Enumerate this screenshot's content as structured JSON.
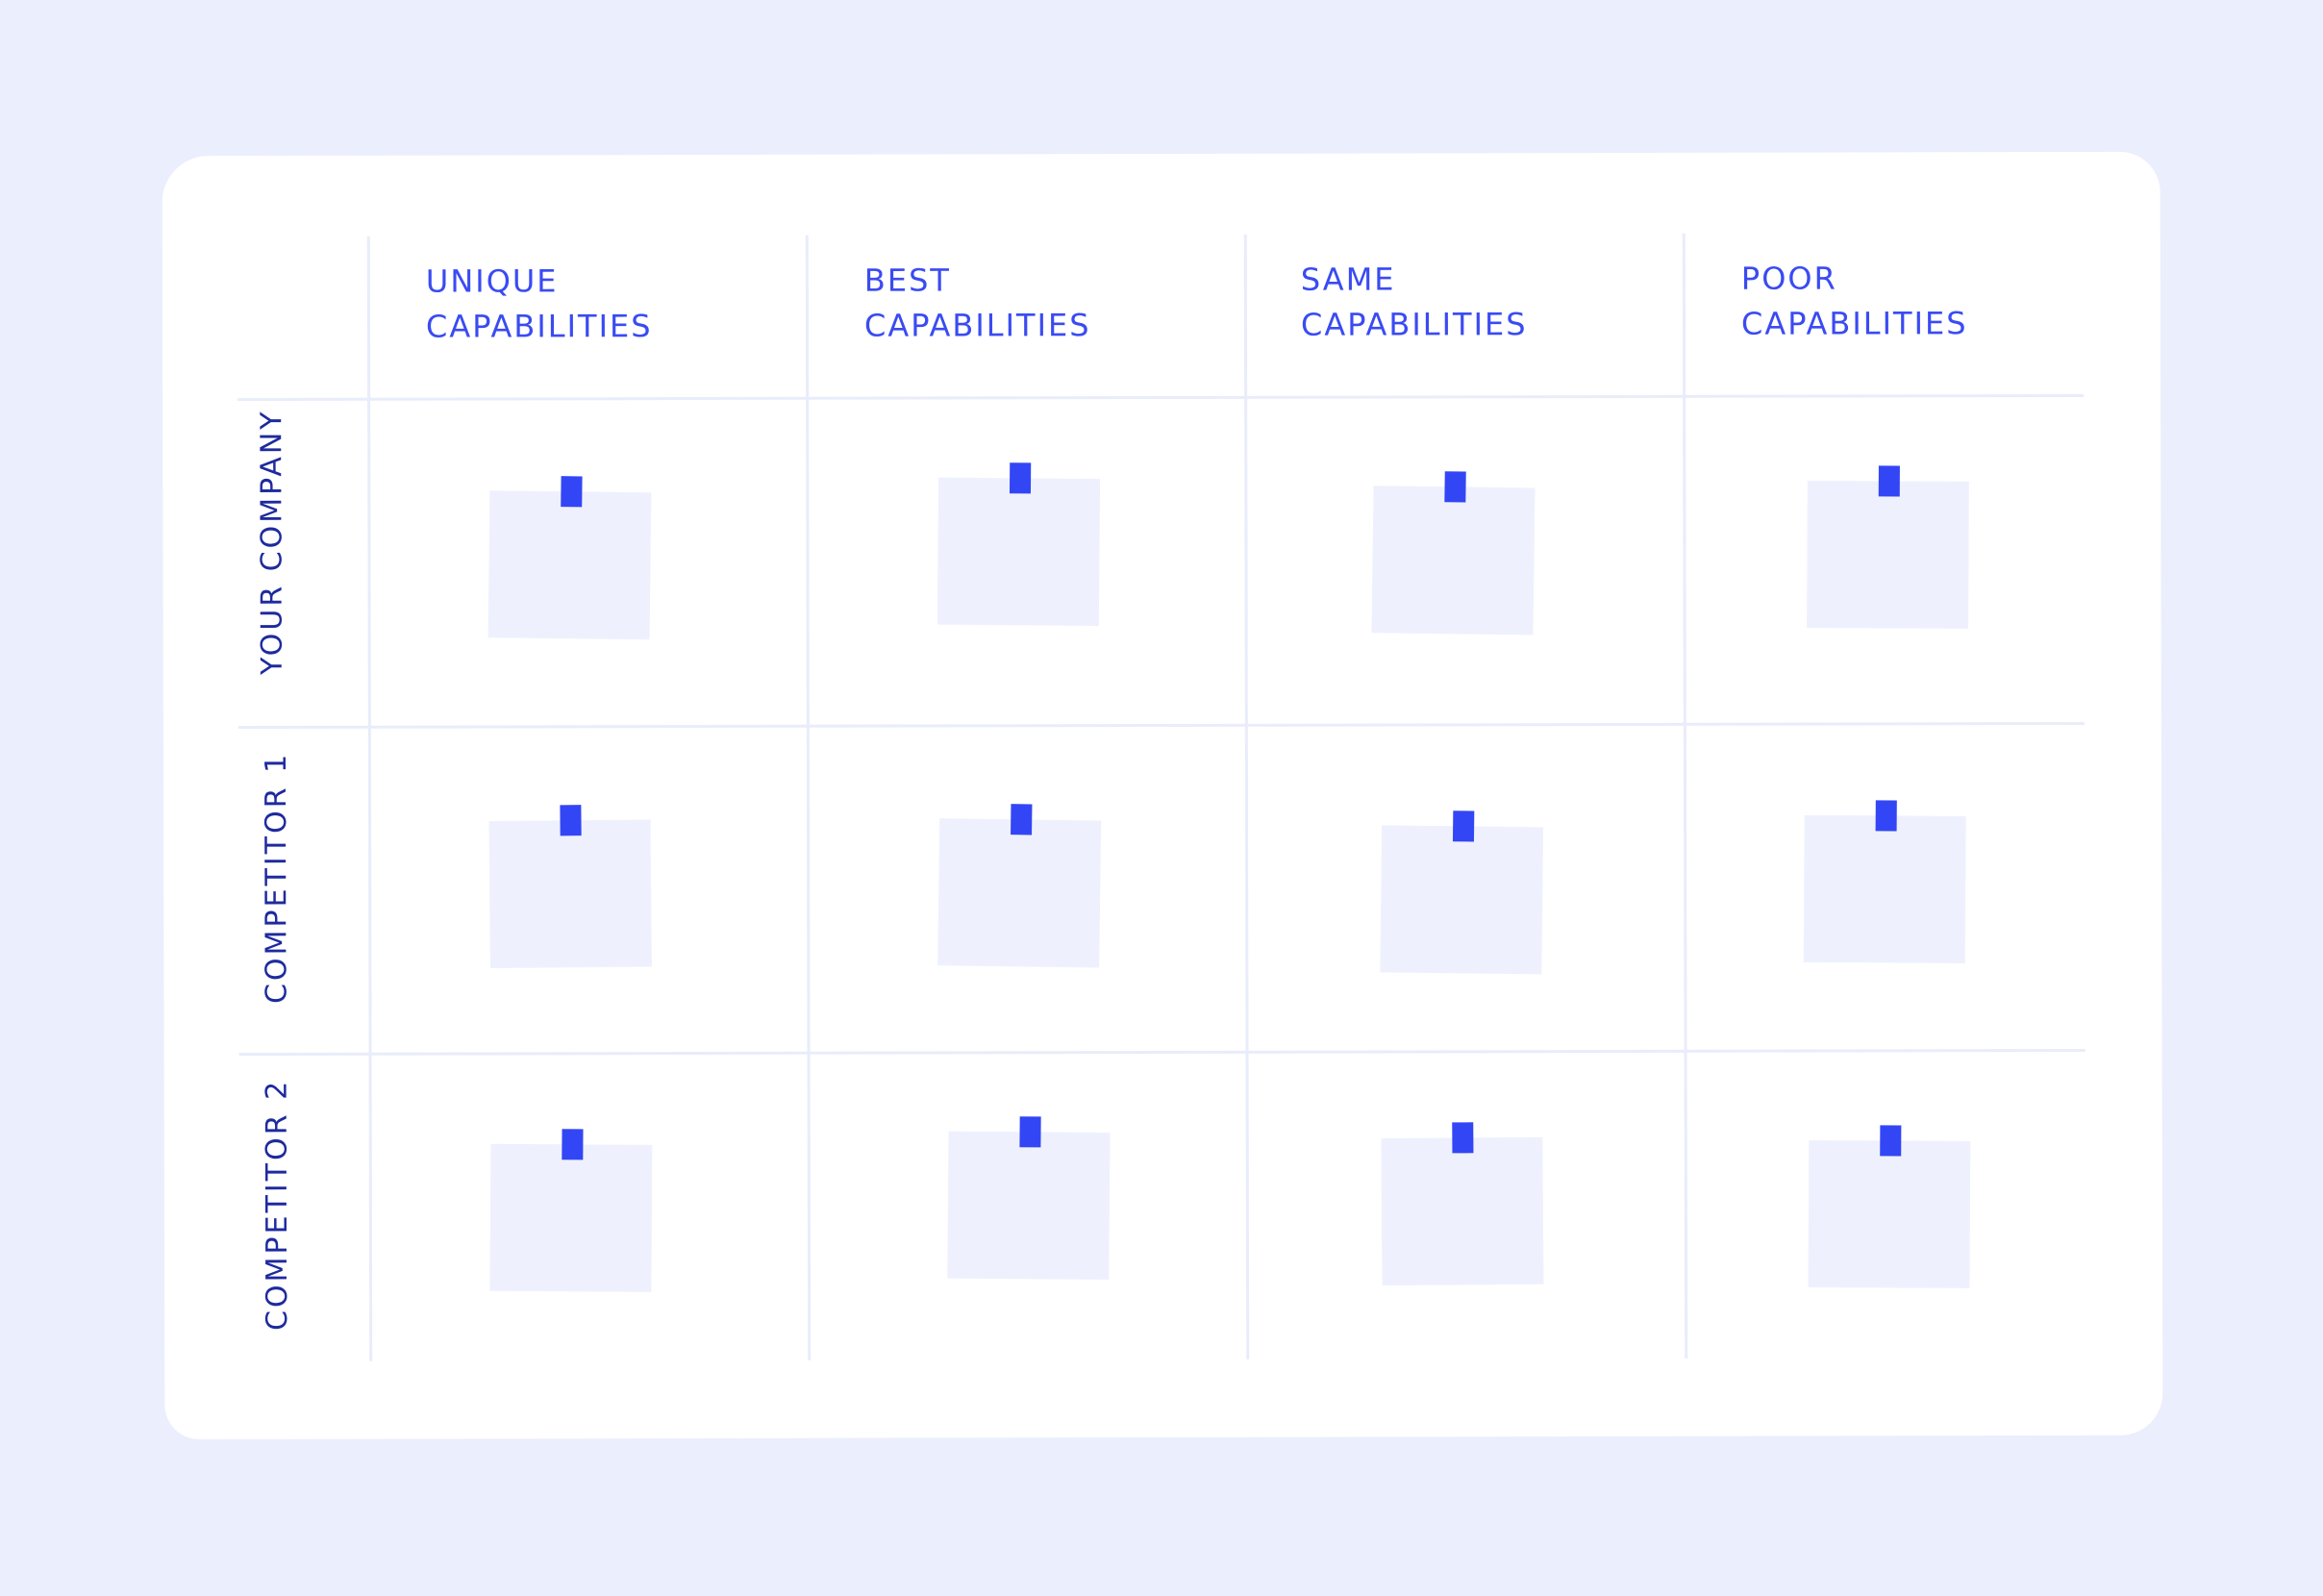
{
  "columns": [
    {
      "line1": "Unique",
      "line2": "capabilities"
    },
    {
      "line1": "Best",
      "line2": "capabilities"
    },
    {
      "line1": "Same",
      "line2": "capabilities"
    },
    {
      "line1": "Poor",
      "line2": "capabilities"
    }
  ],
  "rows": [
    {
      "label": "Your company"
    },
    {
      "label": "Competitor 1"
    },
    {
      "label": "Competitor 2"
    }
  ],
  "colors": {
    "background": "#EBEEFC",
    "board": "#FFFFFF",
    "header_text": "#3A4BF2",
    "row_text": "#1E2A9E",
    "sticky_note": "#EEF1FD",
    "tape": "#3346F5"
  }
}
